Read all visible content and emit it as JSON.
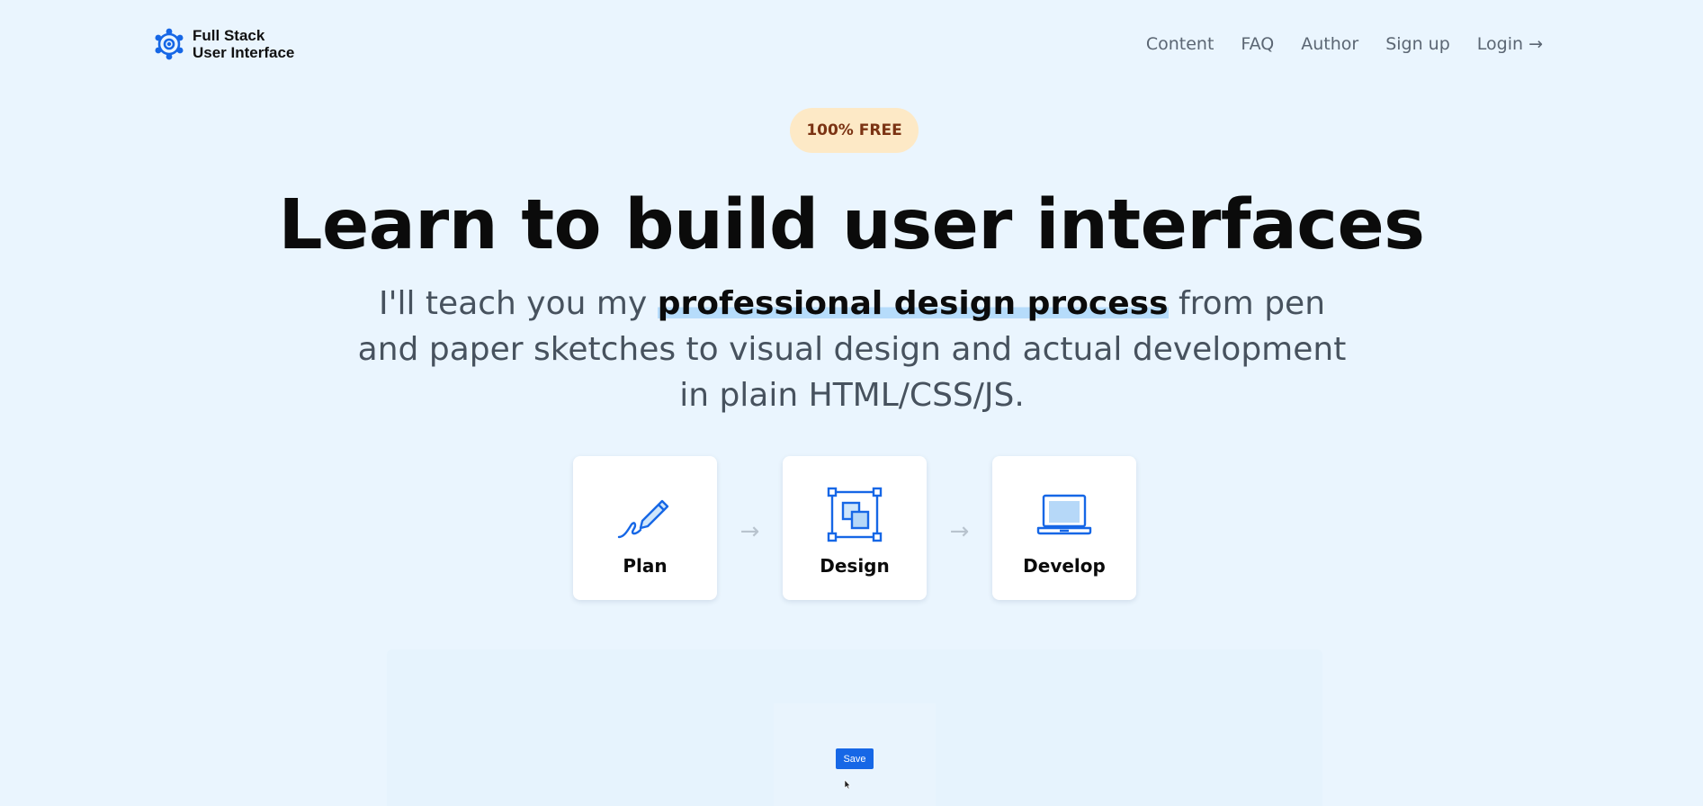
{
  "logo": {
    "line1": "Full Stack",
    "line2": "User Interface",
    "icon": "gear-logo-icon",
    "color": "#1667e6"
  },
  "nav": {
    "items": [
      "Content",
      "FAQ",
      "Author",
      "Sign up",
      "Login →"
    ]
  },
  "hero": {
    "badge": "100% FREE",
    "headline": "Learn to build user interfaces",
    "sub_before": "I'll teach you my ",
    "sub_highlight": "professional design process",
    "sub_after": " from pen and paper sketches to visual design and actual development in plain HTML/CSS/JS."
  },
  "steps": [
    {
      "label": "Plan",
      "icon": "pen-icon"
    },
    {
      "label": "Design",
      "icon": "design-frame-icon"
    },
    {
      "label": "Develop",
      "icon": "laptop-icon"
    }
  ],
  "step_arrow": "→",
  "preview": {
    "save_label": "Save"
  },
  "colors": {
    "background": "#eaf5fe",
    "accent": "#1667e6",
    "badge_bg": "#fde9c6",
    "badge_text": "#7b3313",
    "highlight": "#b6dcfb",
    "nav_text": "#5b6673",
    "body_text": "#47525e"
  }
}
